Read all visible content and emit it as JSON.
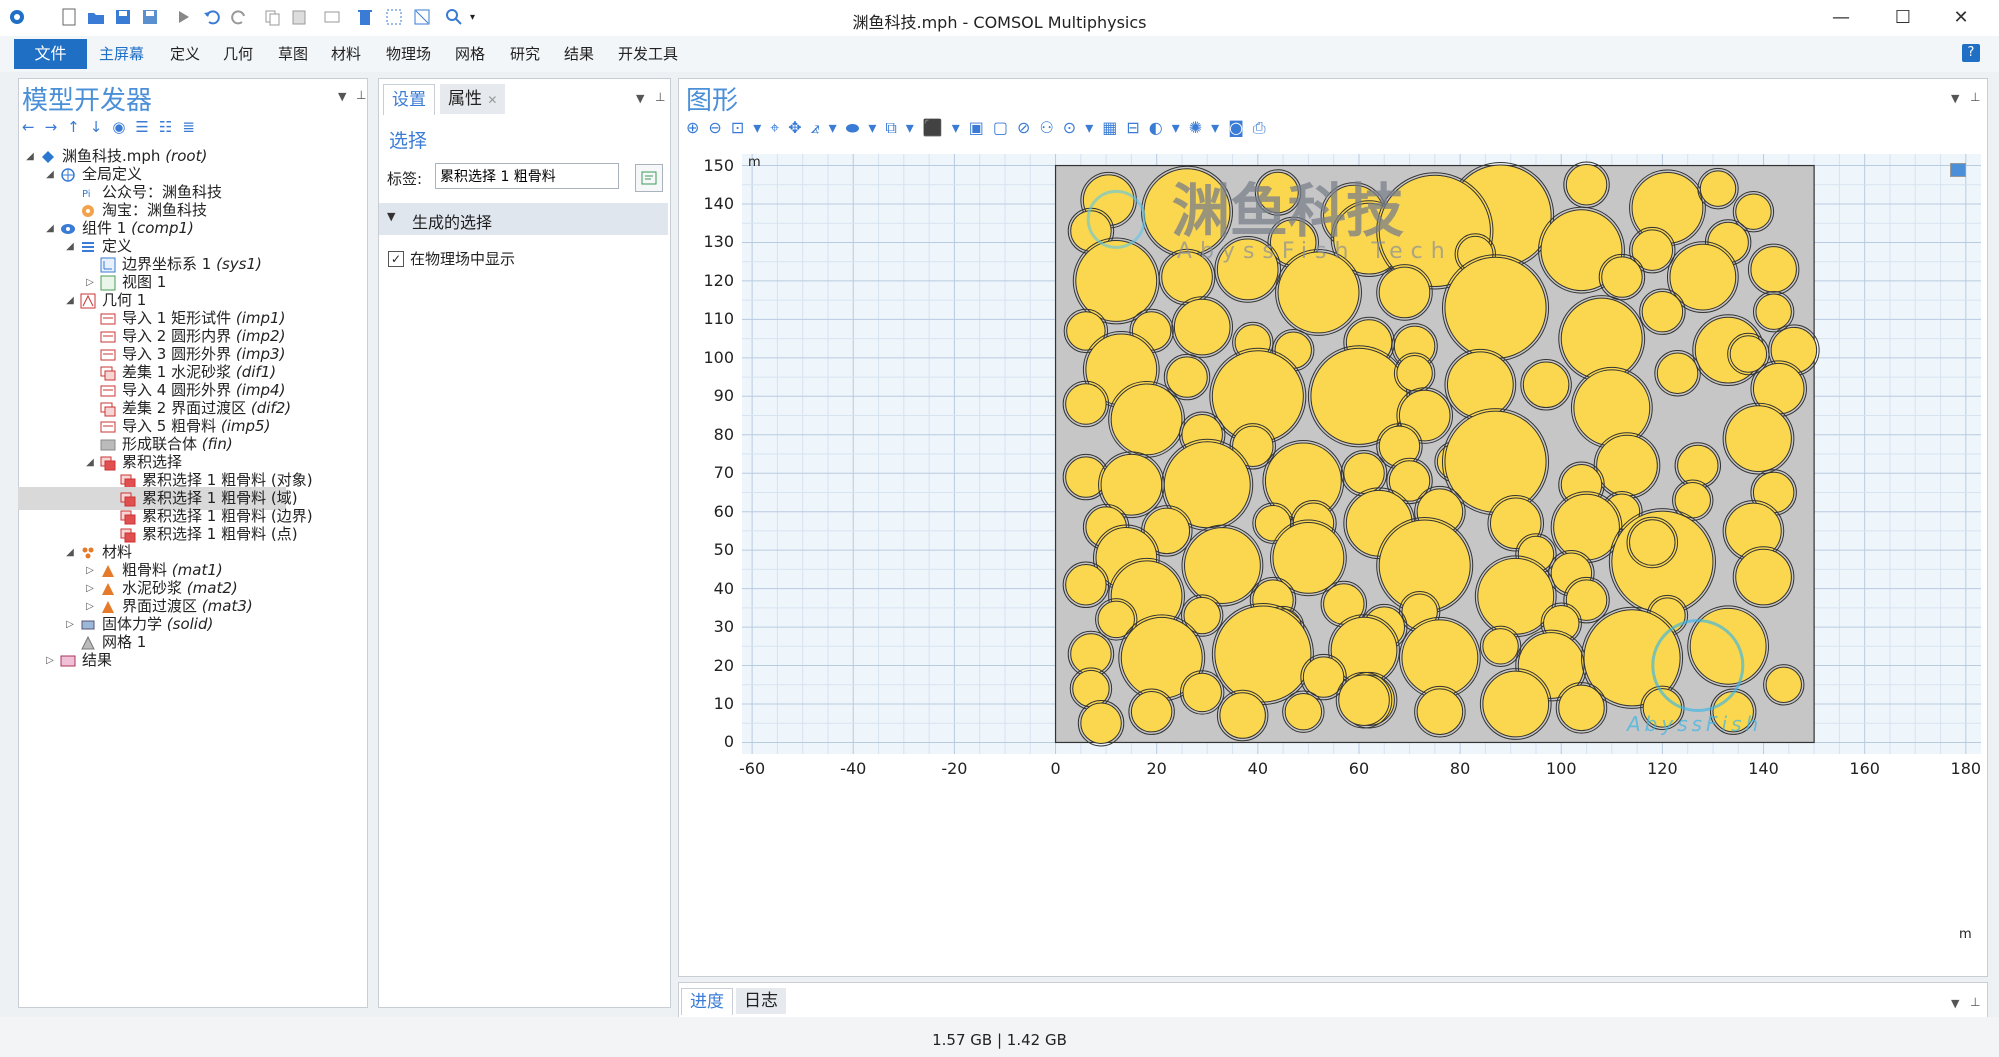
{
  "window": {
    "title": "渊鱼科技.mph - COMSOL Multiphysics",
    "min": "—",
    "max": "☐",
    "close": "✕"
  },
  "menu": {
    "file": "文件",
    "items": [
      "主屏幕",
      "定义",
      "几何",
      "草图",
      "材料",
      "物理场",
      "网格",
      "研究",
      "结果",
      "开发工具"
    ],
    "help": "?"
  },
  "model_builder": {
    "title": "模型开发器",
    "tree": [
      {
        "label": "渊鱼科技.mph",
        "tag": "(root)",
        "level": 0,
        "exp": "◢",
        "icon": "model-file-icon"
      },
      {
        "label": "全局定义",
        "tag": "",
        "level": 1,
        "exp": "◢",
        "icon": "globe-icon"
      },
      {
        "label": "公众号：渊鱼科技",
        "tag": "",
        "level": 2,
        "exp": "",
        "icon": "parameter-icon"
      },
      {
        "label": "淘宝：渊鱼科技",
        "tag": "",
        "level": 2,
        "exp": "",
        "icon": "material-ball-icon"
      },
      {
        "label": "组件 1",
        "tag": "(comp1)",
        "level": 1,
        "exp": "◢",
        "icon": "component-icon"
      },
      {
        "label": "定义",
        "tag": "",
        "level": 2,
        "exp": "◢",
        "icon": "definitions-icon"
      },
      {
        "label": "边界坐标系 1",
        "tag": "(sys1)",
        "level": 3,
        "exp": "",
        "icon": "coordinate-system-icon"
      },
      {
        "label": "视图 1",
        "tag": "",
        "level": 3,
        "exp": "▷",
        "icon": "view-icon"
      },
      {
        "label": "几何 1",
        "tag": "",
        "level": 2,
        "exp": "◢",
        "icon": "geometry-icon"
      },
      {
        "label": "导入 1 矩形试件",
        "tag": "(imp1)",
        "level": 3,
        "exp": "",
        "icon": "import-icon"
      },
      {
        "label": "导入 2 圆形内界",
        "tag": "(imp2)",
        "level": 3,
        "exp": "",
        "icon": "import-icon"
      },
      {
        "label": "导入 3 圆形外界",
        "tag": "(imp3)",
        "level": 3,
        "exp": "",
        "icon": "import-icon"
      },
      {
        "label": "差集 1 水泥砂浆",
        "tag": "(dif1)",
        "level": 3,
        "exp": "",
        "icon": "difference-icon"
      },
      {
        "label": "导入 4 圆形外界",
        "tag": "(imp4)",
        "level": 3,
        "exp": "",
        "icon": "import-icon"
      },
      {
        "label": "差集 2 界面过渡区",
        "tag": "(dif2)",
        "level": 3,
        "exp": "",
        "icon": "difference-icon"
      },
      {
        "label": "导入 5 粗骨料",
        "tag": "(imp5)",
        "level": 3,
        "exp": "",
        "icon": "import-icon"
      },
      {
        "label": "形成联合体",
        "tag": "(fin)",
        "level": 3,
        "exp": "",
        "icon": "form-union-icon"
      },
      {
        "label": "累积选择",
        "tag": "",
        "level": 3,
        "exp": "◢",
        "icon": "selection-icon"
      },
      {
        "label": "累积选择 1 粗骨料 (对象)",
        "tag": "",
        "level": 4,
        "exp": "",
        "icon": "selection-icon"
      },
      {
        "label": "累积选择 1 粗骨料 (域)",
        "tag": "",
        "level": 4,
        "exp": "",
        "icon": "selection-icon",
        "selected": true
      },
      {
        "label": "累积选择 1 粗骨料 (边界)",
        "tag": "",
        "level": 4,
        "exp": "",
        "icon": "selection-icon"
      },
      {
        "label": "累积选择 1 粗骨料 (点)",
        "tag": "",
        "level": 4,
        "exp": "",
        "icon": "selection-icon"
      },
      {
        "label": "材料",
        "tag": "",
        "level": 2,
        "exp": "◢",
        "icon": "materials-icon"
      },
      {
        "label": "粗骨料",
        "tag": "(mat1)",
        "level": 3,
        "exp": "▷",
        "icon": "material-icon"
      },
      {
        "label": "水泥砂浆",
        "tag": "(mat2)",
        "level": 3,
        "exp": "▷",
        "icon": "material-icon"
      },
      {
        "label": "界面过渡区",
        "tag": "(mat3)",
        "level": 3,
        "exp": "▷",
        "icon": "material-icon"
      },
      {
        "label": "固体力学",
        "tag": "(solid)",
        "level": 2,
        "exp": "▷",
        "icon": "solid-mechanics-icon"
      },
      {
        "label": "网格 1",
        "tag": "",
        "level": 2,
        "exp": "",
        "icon": "mesh-icon"
      },
      {
        "label": "结果",
        "tag": "",
        "level": 1,
        "exp": "▷",
        "icon": "results-icon"
      }
    ]
  },
  "settings": {
    "tab_settings": "设置",
    "tab_properties": "属性",
    "close": "✕",
    "heading": "选择",
    "label_caption": "标签:",
    "label_value": "累积选择 1 粗骨料",
    "section": "生成的选择",
    "checkbox_label": "在物理场中显示",
    "checkbox_checked": true
  },
  "graphics": {
    "title": "图形",
    "unit_label": "m",
    "x_ticks": [
      "-60",
      "-40",
      "-20",
      "0",
      "20",
      "40",
      "60",
      "80",
      "100",
      "120",
      "140",
      "160",
      "180"
    ],
    "y_ticks": [
      "0",
      "10",
      "20",
      "30",
      "40",
      "50",
      "60",
      "70",
      "80",
      "90",
      "100",
      "110",
      "120",
      "130",
      "140",
      "150"
    ],
    "x_range": [
      -62,
      183
    ],
    "y_range": [
      -3,
      153
    ],
    "specimen": {
      "x": [
        0,
        150
      ],
      "y": [
        0,
        150
      ],
      "fill": "#c6c6c6"
    },
    "aggregate_fill": "#fad74e",
    "itz_stroke": "#333333",
    "watermark_cn": "渊鱼科技",
    "watermark_en": "AbyssFish Tech",
    "watermark_logo_text": "AbyssFish",
    "aggregates": [
      [
        10.5,
        141,
        5
      ],
      [
        26,
        138,
        8.5
      ],
      [
        44,
        143,
        4
      ],
      [
        59,
        137,
        6
      ],
      [
        73,
        140,
        4.5
      ],
      [
        88,
        137,
        10
      ],
      [
        105,
        145,
        4
      ],
      [
        121,
        139,
        7
      ],
      [
        131,
        144,
        3.5
      ],
      [
        138,
        138,
        3.5
      ],
      [
        7,
        133,
        4
      ],
      [
        47,
        130,
        4.5
      ],
      [
        62,
        131,
        7
      ],
      [
        75,
        133,
        11
      ],
      [
        83,
        127,
        3.5
      ],
      [
        104,
        128,
        8
      ],
      [
        118,
        128,
        4
      ],
      [
        133,
        130,
        4
      ],
      [
        12,
        120,
        8
      ],
      [
        26,
        121,
        5
      ],
      [
        38,
        123,
        6
      ],
      [
        52,
        117,
        8
      ],
      [
        69,
        117,
        5
      ],
      [
        87,
        113,
        10
      ],
      [
        112,
        121,
        4
      ],
      [
        128,
        121,
        6.5
      ],
      [
        142,
        123,
        4.5
      ],
      [
        6,
        107,
        3.8
      ],
      [
        19,
        107,
        3.8
      ],
      [
        29,
        108,
        5.5
      ],
      [
        39,
        104,
        3.5
      ],
      [
        47,
        102,
        3.6
      ],
      [
        62,
        104,
        4.5
      ],
      [
        71,
        103,
        4
      ],
      [
        108,
        105,
        8
      ],
      [
        120,
        112,
        4
      ],
      [
        133,
        102,
        6.5
      ],
      [
        142,
        112,
        3.5
      ],
      [
        146,
        102,
        4.5
      ],
      [
        13,
        97,
        7
      ],
      [
        26,
        95,
        4
      ],
      [
        40,
        90,
        9
      ],
      [
        60,
        90,
        9.5
      ],
      [
        71,
        96,
        3.5
      ],
      [
        84,
        93,
        6.5
      ],
      [
        97,
        93,
        4.5
      ],
      [
        110,
        87,
        7.5
      ],
      [
        123,
        96,
        4
      ],
      [
        137,
        101,
        3.6
      ],
      [
        143,
        92,
        5
      ],
      [
        6,
        88,
        4
      ],
      [
        18,
        84,
        7
      ],
      [
        29,
        80,
        4
      ],
      [
        73,
        85,
        5
      ],
      [
        39,
        77,
        4
      ],
      [
        68,
        77,
        4
      ],
      [
        79,
        73,
        3.5
      ],
      [
        87,
        73,
        10
      ],
      [
        113,
        72,
        6
      ],
      [
        127,
        72,
        4
      ],
      [
        139,
        79,
        6.5
      ],
      [
        6,
        69,
        4
      ],
      [
        15,
        67,
        6
      ],
      [
        30,
        67,
        8.5
      ],
      [
        49,
        68,
        7.5
      ],
      [
        61,
        70,
        4
      ],
      [
        70,
        68,
        4
      ],
      [
        104,
        67,
        4
      ],
      [
        112,
        60,
        3.5
      ],
      [
        126,
        63,
        3.5
      ],
      [
        142,
        65,
        4
      ],
      [
        10,
        56,
        4
      ],
      [
        22,
        55,
        4.5
      ],
      [
        43,
        57,
        3.5
      ],
      [
        51,
        57,
        4
      ],
      [
        64,
        57,
        6.5
      ],
      [
        76,
        60,
        4.5
      ],
      [
        91,
        57,
        5
      ],
      [
        105,
        56,
        6.5
      ],
      [
        120,
        47,
        10
      ],
      [
        138,
        55,
        5.5
      ],
      [
        14,
        48,
        6
      ],
      [
        33,
        46,
        7.5
      ],
      [
        50,
        48,
        7
      ],
      [
        73,
        46,
        9
      ],
      [
        95,
        49,
        3.5
      ],
      [
        102,
        44,
        4
      ],
      [
        118,
        52,
        4.5
      ],
      [
        140,
        43,
        5.5
      ],
      [
        6,
        41,
        4
      ],
      [
        18,
        38,
        7
      ],
      [
        43,
        37,
        4
      ],
      [
        57,
        36,
        4
      ],
      [
        72,
        34,
        3.5
      ],
      [
        91,
        38,
        7.5
      ],
      [
        105,
        37,
        4
      ],
      [
        12,
        32,
        3.6
      ],
      [
        29,
        33,
        3.6
      ],
      [
        45,
        30,
        3.6
      ],
      [
        65,
        30,
        4
      ],
      [
        100,
        31,
        3.5
      ],
      [
        121,
        33,
        3.5
      ],
      [
        7,
        23,
        4
      ],
      [
        21,
        22,
        8
      ],
      [
        41,
        23,
        9.5
      ],
      [
        61,
        24,
        6.5
      ],
      [
        76,
        22,
        7.5
      ],
      [
        88,
        25,
        3.5
      ],
      [
        98,
        20,
        6.5
      ],
      [
        114,
        22,
        9.5
      ],
      [
        133,
        25,
        7.5
      ],
      [
        7,
        14,
        3.6
      ],
      [
        29,
        13,
        3.8
      ],
      [
        53,
        17,
        4
      ],
      [
        62,
        11,
        5
      ],
      [
        9,
        5,
        4
      ],
      [
        19,
        8,
        4
      ],
      [
        37,
        7,
        4.5
      ],
      [
        49,
        8,
        3.6
      ],
      [
        61,
        11,
        5
      ],
      [
        76,
        8,
        4.5
      ],
      [
        91,
        10,
        6.5
      ],
      [
        104,
        9,
        4.5
      ],
      [
        120,
        9,
        3.8
      ],
      [
        134,
        8,
        4
      ],
      [
        144,
        15,
        3.5
      ]
    ]
  },
  "bottom_tabs": {
    "progress": "进度",
    "log": "日志"
  },
  "status": {
    "memory": "1.57 GB | 1.42 GB"
  }
}
